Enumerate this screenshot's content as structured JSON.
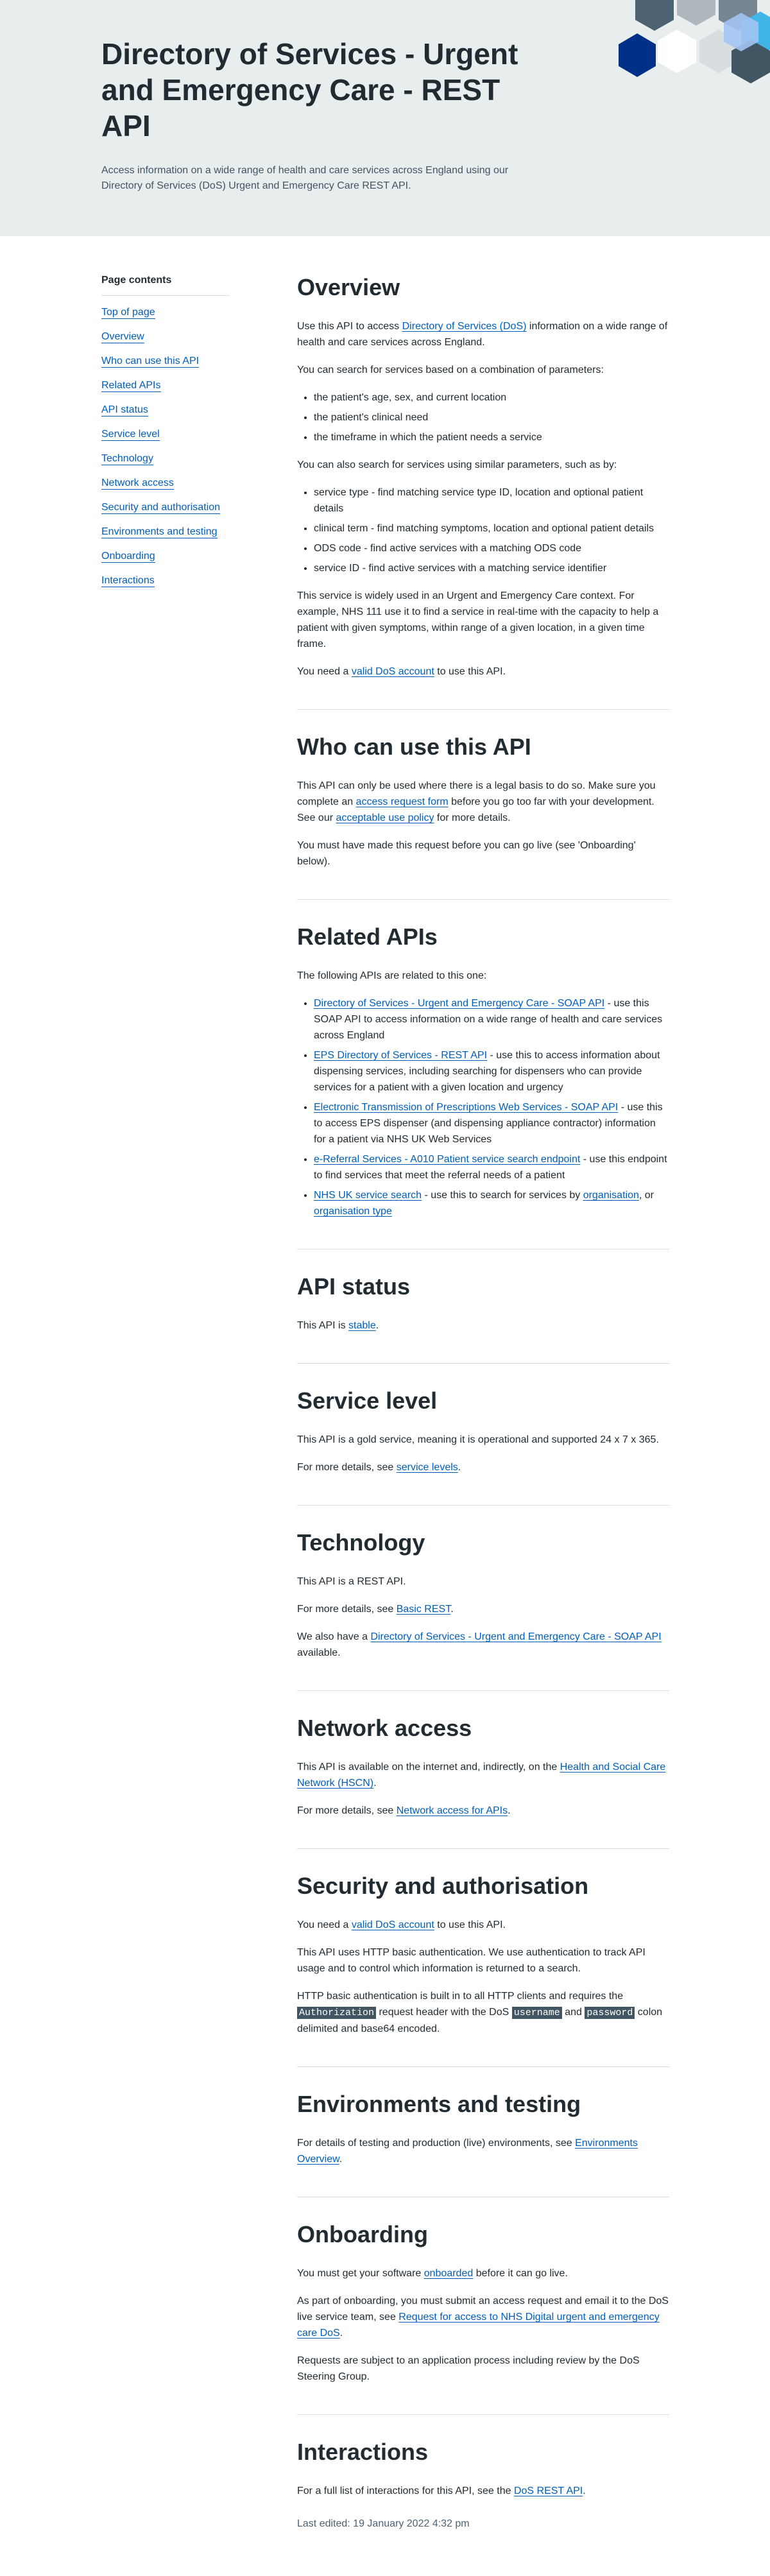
{
  "hero": {
    "title": "Directory of Services - Urgent and Emergency Care - REST API",
    "intro": "Access information on a wide range of health and care services across England using our Directory of Services (DoS) Urgent and Emergency Care REST API."
  },
  "colors": {
    "link": "#005eb8",
    "hero_bg": "#e8edee",
    "text": "#212b32",
    "code_bg": "#425563"
  },
  "toc": {
    "title": "Page contents",
    "items": [
      "Top of page",
      "Overview",
      "Who can use this API",
      "Related APIs",
      "API status",
      "Service level",
      "Technology",
      "Network access",
      "Security and authorisation",
      "Environments and testing",
      "Onboarding",
      "Interactions"
    ]
  },
  "overview": {
    "heading": "Overview",
    "p1_pre": "Use this API to access ",
    "p1_link": "Directory of Services (DoS)",
    "p1_post": " information on a wide range of health and care services across England.",
    "p2": "You can search for services based on a combination of parameters:",
    "list1": [
      "the patient's age, sex, and current location",
      "the patient's clinical need",
      "the timeframe in which the patient needs a service"
    ],
    "p3": "You can also search for services using similar parameters, such as by:",
    "list2": [
      "service type - find matching service type ID, location and optional patient details",
      "clinical term - find matching symptoms, location and optional patient details",
      "ODS code - find active services with a matching ODS code",
      "service ID - find active services with a matching service identifier"
    ],
    "p4": "This service is widely used in an Urgent and Emergency Care context. For example, NHS 111 use it to find a service in real-time with the capacity to help a patient with given symptoms, within range of a given location, in a given time frame.",
    "p5_pre": "You need a ",
    "p5_link": "valid DoS account",
    "p5_post": " to use this API."
  },
  "who": {
    "heading": "Who can use this API",
    "p1_a": "This API can only be used where there is a legal basis to do so. Make sure you complete an ",
    "p1_link1": "access request form",
    "p1_b": " before you go too far with your development. See our ",
    "p1_link2": "acceptable use policy",
    "p1_c": " for more details.",
    "p2": "You must have made this request before you can go live (see 'Onboarding' below)."
  },
  "related": {
    "heading": "Related APIs",
    "intro": "The following APIs are related to this one:",
    "items": [
      {
        "link": "Directory of Services - Urgent and Emergency Care - SOAP API",
        "text": " - use this SOAP API to access information on a wide range of health and care services across England"
      },
      {
        "link": "EPS Directory of Services - REST API",
        "text": " - use this to access information about dispensing services, including searching for dispensers who can provide services for a patient with a given location and urgency"
      },
      {
        "link": "Electronic Transmission of Prescriptions Web Services - SOAP API",
        "text": " - use this to access EPS dispenser (and dispensing appliance contractor) information for a patient via NHS UK Web Services"
      },
      {
        "link": "e-Referral Services - A010 Patient service search endpoint",
        "text": " - use this endpoint to find services that meet the referral needs of a patient"
      }
    ],
    "last_link": "NHS UK service search",
    "last_a": " - use this to search for services by ",
    "last_link2": "organisation",
    "last_b": ", or ",
    "last_link3": "organisation type"
  },
  "status": {
    "heading": "API status",
    "pre": "This API is ",
    "link": "stable",
    "post": "."
  },
  "service_level": {
    "heading": "Service level",
    "p1": "This API is a gold service, meaning it is operational and supported 24 x 7 x 365.",
    "p2_pre": "For more details, see ",
    "p2_link": "service levels",
    "p2_post": "."
  },
  "technology": {
    "heading": "Technology",
    "p1": "This API is a REST API.",
    "p2_pre": "For more details, see ",
    "p2_link": "Basic REST",
    "p2_post": ".",
    "p3_pre": "We also have a ",
    "p3_link": "Directory of Services - Urgent and Emergency Care - SOAP API",
    "p3_post": " available."
  },
  "network": {
    "heading": "Network access",
    "p1_pre": "This API is available on the internet and, indirectly, on the ",
    "p1_link": "Health and Social Care Network (HSCN)",
    "p1_post": ".",
    "p2_pre": "For more details, see ",
    "p2_link": "Network access for APIs",
    "p2_post": "."
  },
  "security": {
    "heading": "Security and authorisation",
    "p1_pre": "You need a ",
    "p1_link": "valid DoS account",
    "p1_post": " to use this API.",
    "p2": "This API uses HTTP basic authentication. We use authentication to track API usage and to control which information is returned to a search.",
    "p3_a": "HTTP basic authentication is built in to all HTTP clients and requires the ",
    "code1": "Authorization",
    "p3_b": " request header with the DoS ",
    "code2": "username",
    "p3_c": " and ",
    "code3": "password",
    "p3_d": " colon delimited and base64 encoded."
  },
  "environments": {
    "heading": "Environments and testing",
    "p1_pre": "For details of testing and production (live) environments, see ",
    "p1_link": "Environments Overview",
    "p1_post": "."
  },
  "onboarding": {
    "heading": "Onboarding",
    "p1_pre": "You must get your software ",
    "p1_link": "onboarded",
    "p1_post": " before it can go live.",
    "p2_pre": "As part of onboarding, you must submit an access request and email it to the DoS live service team, see ",
    "p2_link": "Request for access to NHS Digital urgent and emergency care DoS",
    "p2_post": ".",
    "p3": "Requests are subject to an application process including review by the DoS Steering Group."
  },
  "interactions": {
    "heading": "Interactions",
    "p1_pre": "For a full list of interactions for this API, see the ",
    "p1_link": "DoS REST API",
    "p1_post": ".",
    "last_edited": "Last edited: 19 January 2022 4:32 pm"
  }
}
